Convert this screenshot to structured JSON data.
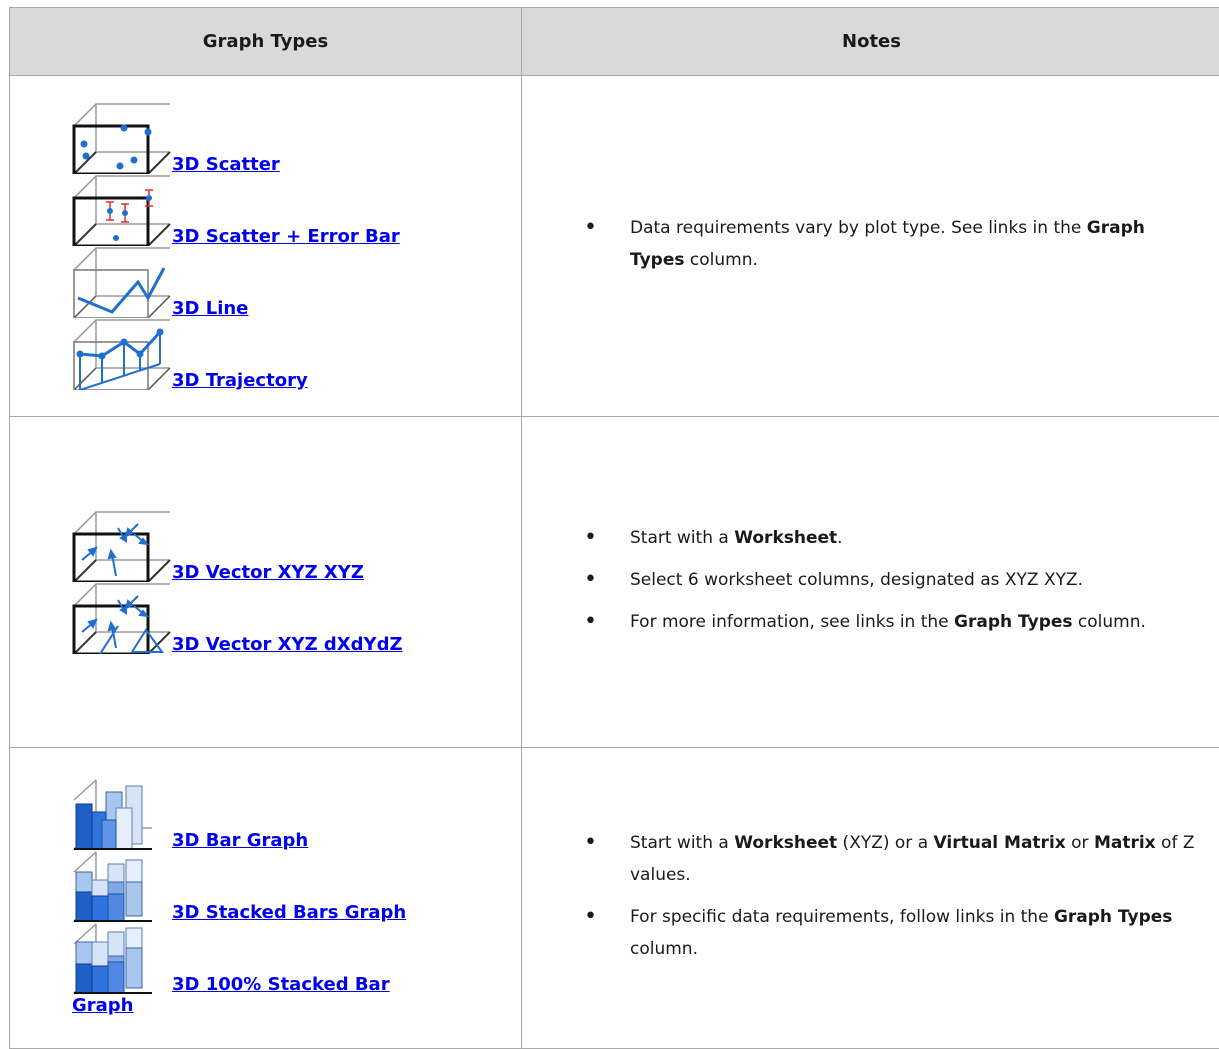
{
  "header": {
    "col1": "Graph Types",
    "col2": "Notes"
  },
  "rows": [
    {
      "types": [
        {
          "label": "3D Scatter",
          "icon": "3d-scatter-icon"
        },
        {
          "label": "3D Scatter + Error Bar",
          "icon": "3d-scatter-error-bar-icon"
        },
        {
          "label": "3D Line",
          "icon": "3d-line-icon"
        },
        {
          "label": "3D Trajectory",
          "icon": "3d-trajectory-icon"
        }
      ],
      "notes": [
        {
          "t1": "Data requirements vary by plot type. See links in the ",
          "b1": "Graph Types",
          "t2": " column."
        }
      ]
    },
    {
      "types": [
        {
          "label": "3D Vector XYZ XYZ",
          "icon": "3d-vector-xyz-xyz-icon"
        },
        {
          "label": "3D Vector XYZ dXdYdZ",
          "icon": "3d-vector-xyz-dxdydz-icon"
        }
      ],
      "notes": [
        {
          "t1": "Start with a ",
          "b1": "Worksheet",
          "t2": "."
        },
        {
          "t1": "Select 6 worksheet columns, designated as XYZ XYZ."
        },
        {
          "t1": "For more information, see links in the ",
          "b1": "Graph Types",
          "t2": " column."
        }
      ]
    },
    {
      "types": [
        {
          "label": "3D Bar Graph",
          "icon": "3d-bar-graph-icon"
        },
        {
          "label": "3D Stacked Bars Graph",
          "icon": "3d-stacked-bars-icon"
        },
        {
          "label": "3D 100% Stacked Bar",
          "label_cont": "Graph",
          "icon": "3d-100-stacked-bar-icon"
        }
      ],
      "notes": [
        {
          "t1": "Start with a ",
          "b1": "Worksheet",
          "t2": " (XYZ) or a ",
          "b2": "Virtual Matrix",
          "t3": " or ",
          "b3": "Matrix",
          "t4": " of Z values."
        },
        {
          "t1": "For specific data requirements, follow links in the ",
          "b1": "Graph Types",
          "t2": " column."
        }
      ]
    }
  ],
  "colors": {
    "link": "#0000ee",
    "header_bg": "#d9d9d9",
    "border": "#a8a8a8",
    "icon_blue": "#1f6fd1",
    "error_red": "#e0302a"
  }
}
